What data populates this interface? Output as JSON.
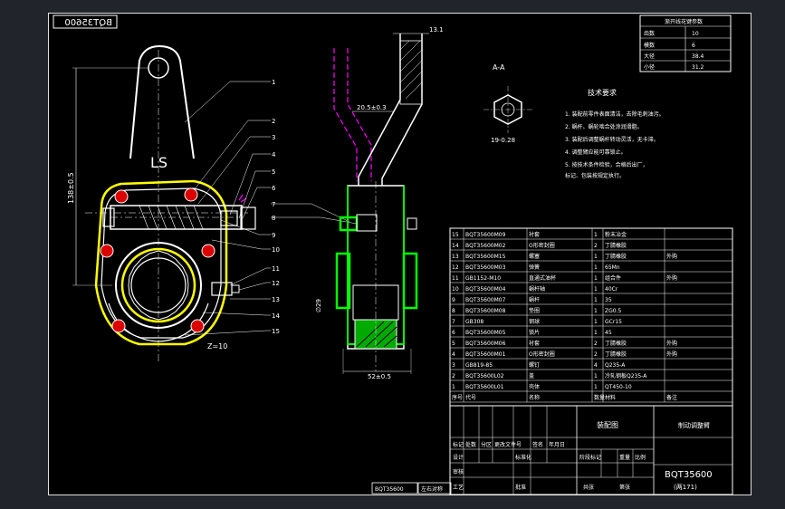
{
  "drawing": {
    "number_mirrored": "BQT35600",
    "number_main": "BQT35600",
    "sheet_note": "(两171)",
    "view_label": "A-A",
    "marking": "LS",
    "bottom_code": "BQT35600",
    "bottom_note": "左右对称"
  },
  "dimensions": {
    "height_main": "138±0.5",
    "width_top": "13.1",
    "width_upper": "20.5±0.3",
    "width_bottom": "52±0.5",
    "dia": "∅29",
    "hex": "19-0.28",
    "teeth": "Z=10"
  },
  "spline_table": {
    "title": "渐开线花键参数",
    "rows": [
      [
        "齿数",
        "10"
      ],
      [
        "模数",
        "6"
      ],
      [
        "大径",
        "38.4"
      ],
      [
        "小径",
        "31.2"
      ]
    ]
  },
  "requirements": {
    "title": "技术要求",
    "items": [
      "1. 装配前零件表面清洁，去除毛刺油污。",
      "2. 蜗杆、蜗轮啮合处涂润滑脂。",
      "3. 装配后调整蜗杆转动灵活，无卡滞。",
      "4. 调整臂应能可靠锁止。",
      "5. 按技术条件检验，合格后出厂，",
      "   标记、包装按规定执行。"
    ]
  },
  "balloons": [
    "1",
    "2",
    "3",
    "4",
    "5",
    "6",
    "7",
    "8",
    "9",
    "10",
    "11",
    "12",
    "13",
    "14",
    "15"
  ],
  "bom": {
    "header": [
      "序号",
      "代号",
      "名称",
      "数量",
      "材料",
      "备注"
    ],
    "rows": [
      [
        "15",
        "BQT35600M09",
        "衬套",
        "1",
        "粉末冶金",
        ""
      ],
      [
        "14",
        "BQT35600M02",
        "O形密封圈",
        "2",
        "丁腈橡胶",
        ""
      ],
      [
        "13",
        "BQT35600M15",
        "螺塞",
        "1",
        "丁腈橡胶",
        "外购"
      ],
      [
        "12",
        "BQT35600M03",
        "弹簧",
        "1",
        "65Mn",
        ""
      ],
      [
        "11",
        "GB1152-M10",
        "直通式油杯",
        "1",
        "组合件",
        "外购"
      ],
      [
        "10",
        "BQT35600M04",
        "蜗杆轴",
        "1",
        "40Cr",
        ""
      ],
      [
        "9",
        "BQT35600M07",
        "蜗杆",
        "1",
        "35",
        ""
      ],
      [
        "8",
        "BQT35600M08",
        "垫圈",
        "1",
        "ZG0.5",
        ""
      ],
      [
        "7",
        "GB308",
        "钢球",
        "1",
        "GCr15",
        ""
      ],
      [
        "6",
        "BQT35600M05",
        "锁片",
        "1",
        "45",
        ""
      ],
      [
        "5",
        "BQT35600M06",
        "衬套",
        "2",
        "丁腈橡胶",
        "外购"
      ],
      [
        "4",
        "BQT35600M01",
        "O形密封圈",
        "2",
        "丁腈橡胶",
        "外购"
      ],
      [
        "3",
        "GB819-85",
        "螺钉",
        "4",
        "Q235-A",
        ""
      ],
      [
        "2",
        "BQT35600L02",
        "盖",
        "1",
        "冷轧钢板Q235-A",
        ""
      ],
      [
        "1",
        "BQT35600L01",
        "壳体",
        "1",
        "QT450-10",
        ""
      ]
    ]
  },
  "title_block": {
    "r1": [
      "标记",
      "处数",
      "分区",
      "更改文件号",
      "签名",
      "年月日"
    ],
    "r2": [
      "设计",
      "标准化",
      "阶段标记",
      "重量",
      "比例"
    ],
    "r3": [
      "审核"
    ],
    "r4": [
      "工艺",
      "批准",
      "共张",
      "第张"
    ],
    "assembly": "装配图",
    "name": "制动调整臂"
  }
}
